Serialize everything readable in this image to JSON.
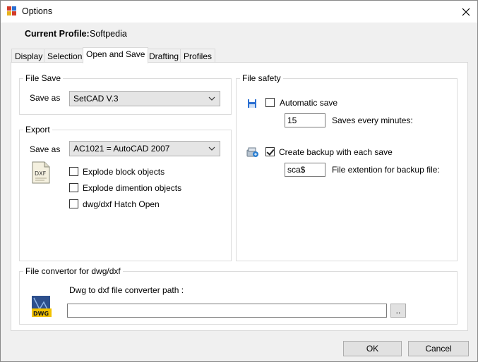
{
  "window": {
    "title": "Options"
  },
  "profile": {
    "label": "Current Profile:",
    "value": "Softpedia"
  },
  "tabs": [
    {
      "label": "Display",
      "active": false
    },
    {
      "label": "Selection",
      "active": false
    },
    {
      "label": "Open and Save",
      "active": true
    },
    {
      "label": "Drafting",
      "active": false
    },
    {
      "label": "Profiles",
      "active": false
    }
  ],
  "file_save": {
    "title": "File Save",
    "save_as_label": "Save as",
    "save_as_value": "SetCAD V.3"
  },
  "export": {
    "title": "Export",
    "save_as_label": "Save as",
    "save_as_value": "AC1021 = AutoCAD 2007",
    "options": [
      {
        "label": "Explode block objects",
        "checked": false
      },
      {
        "label": "Explode dimention objects",
        "checked": false
      },
      {
        "label": "dwg/dxf Hatch Open",
        "checked": false
      }
    ],
    "icon_text": "DXF"
  },
  "file_safety": {
    "title": "File safety",
    "automatic_save": {
      "label": "Automatic save",
      "checked": false
    },
    "minutes_value": "15",
    "minutes_label": "Saves every minutes:",
    "create_backup": {
      "label": "Create backup with each save",
      "checked": true
    },
    "backup_ext_value": "sca$",
    "backup_ext_label": "File extention for backup file:"
  },
  "converter": {
    "title": "File convertor for dwg/dxf",
    "path_label": "Dwg to dxf file converter path :",
    "path_value": "",
    "browse_label": "..",
    "icon_text": "DWG"
  },
  "buttons": {
    "ok": "OK",
    "cancel": "Cancel"
  },
  "colors": {
    "dialog_bg": "#f0f0f0",
    "page_bg": "#ffffff",
    "combo_bg": "#e5e5e5",
    "dwg_yellow": "#f2c200"
  }
}
